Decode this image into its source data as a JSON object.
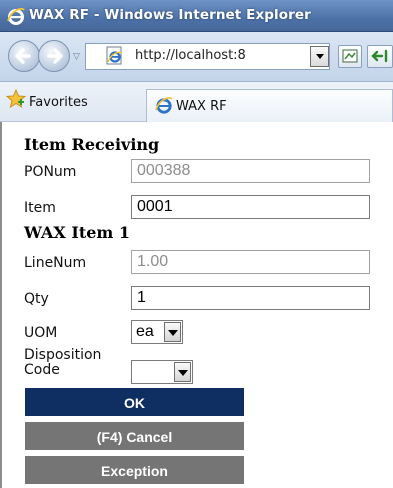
{
  "window": {
    "title": "WAX RF - Windows Internet Explorer"
  },
  "nav": {
    "back_icon": "back-arrow-icon",
    "forward_icon": "forward-arrow-icon",
    "address": "http://localhost:8",
    "page_icon": "ie-page-icon"
  },
  "favorites": {
    "label": "Favorites",
    "tab_label": "WAX RF"
  },
  "form": {
    "section1_title": "Item Receiving",
    "ponum_label": "PONum",
    "ponum_value": "000388",
    "item_label": "Item",
    "item_value": "0001",
    "section2_title": "WAX Item 1",
    "linenum_label": "LineNum",
    "linenum_value": "1.00",
    "qty_label": "Qty",
    "qty_value": "1",
    "uom_label": "UOM",
    "uom_value": "ea",
    "disposition_label_line1": "Disposition",
    "disposition_label_line2": "Code",
    "disposition_value": ""
  },
  "buttons": {
    "ok": "OK",
    "cancel": "(F4) Cancel",
    "exception": "Exception"
  },
  "colors": {
    "ok_button": "#0f2f63",
    "secondary_button": "#757575",
    "titlebar": "#4d72a8"
  }
}
